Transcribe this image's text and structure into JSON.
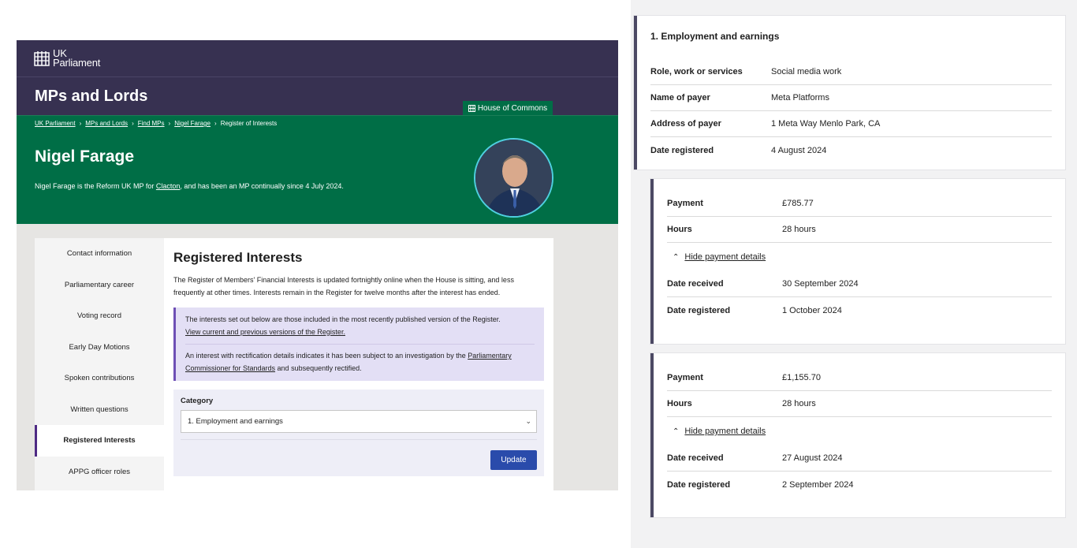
{
  "header": {
    "logo_line1": "UK",
    "logo_line2": "Parliament",
    "site_title": "MPs and Lords",
    "house_tab": "House of Commons"
  },
  "breadcrumb": [
    "UK Parliament",
    "MPs and Lords",
    "Find MPs",
    "Nigel Farage",
    "Register of Interests"
  ],
  "profile": {
    "name": "Nigel Farage",
    "desc_before": "Nigel Farage is the Reform UK MP for ",
    "constituency": "Clacton",
    "desc_after": ", and has been an MP continually since 4 July 2024."
  },
  "sidebar": {
    "items": [
      {
        "label": "Contact information"
      },
      {
        "label": "Parliamentary career"
      },
      {
        "label": "Voting record"
      },
      {
        "label": "Early Day Motions"
      },
      {
        "label": "Spoken contributions"
      },
      {
        "label": "Written questions"
      },
      {
        "label": "Registered Interests",
        "active": true
      },
      {
        "label": "APPG officer roles"
      }
    ]
  },
  "main": {
    "title": "Registered Interests",
    "description": "The Register of Members' Financial Interests is updated fortnightly online when the House is sitting, and less frequently at other times. Interests remain in the Register for twelve months after the interest has ended.",
    "notice1_text": "The interests set out below are those included in the most recently published version of the Register.",
    "notice1_link": "View current and previous versions of the Register.",
    "notice2_before": "An interest with rectification details indicates it has been subject to an investigation by the ",
    "notice2_link": "Parliamentary Commissioner for Standards",
    "notice2_after": " and subsequently rectified.",
    "category_label": "Category",
    "category_value": "1. Employment and earnings",
    "update_label": "Update"
  },
  "interest_card": {
    "heading": "1. Employment and earnings",
    "rows": [
      {
        "k": "Role, work or services",
        "v": "Social media work"
      },
      {
        "k": "Name of payer",
        "v": "Meta Platforms"
      },
      {
        "k": "Address of payer",
        "v": "1 Meta Way Menlo Park, CA"
      },
      {
        "k": "Date registered",
        "v": "4 August 2024"
      }
    ]
  },
  "payments": [
    {
      "payment_label": "Payment",
      "payment": "£785.77",
      "hours_label": "Hours",
      "hours": "28 hours",
      "toggle": "Hide payment details",
      "received_label": "Date received",
      "received": "30 September 2024",
      "registered_label": "Date registered",
      "registered": "1 October 2024"
    },
    {
      "payment_label": "Payment",
      "payment": "£1,155.70",
      "hours_label": "Hours",
      "hours": "28 hours",
      "toggle": "Hide payment details",
      "received_label": "Date received",
      "received": "27 August 2024",
      "registered_label": "Date registered",
      "registered": "2 September 2024"
    }
  ],
  "colors": {
    "header_purple": "#373151",
    "commons_green": "#006e46",
    "accent_purple": "#4e2a84",
    "button_blue": "#2a4bab"
  }
}
